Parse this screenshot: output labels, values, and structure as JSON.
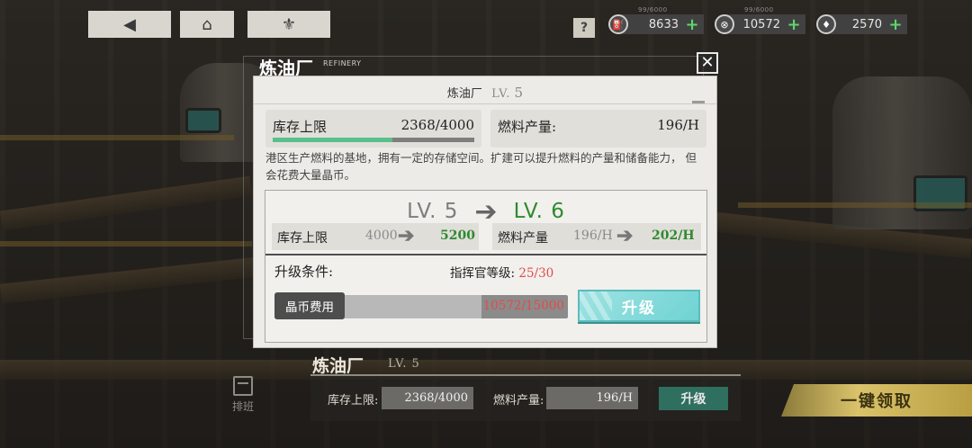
{
  "topbar": {
    "back_label": "◀",
    "home_label": "⌂",
    "base_label": "⚜",
    "help_label": "?"
  },
  "resources": [
    {
      "icon": "oil-icon",
      "glyph": "⛽",
      "caption": "99/6000",
      "value": "8633",
      "plus": "+"
    },
    {
      "icon": "coin-icon",
      "glyph": "⊗",
      "caption": "99/6000",
      "value": "10572",
      "plus": "+"
    },
    {
      "icon": "gem-icon",
      "glyph": "♦",
      "caption": "",
      "value": "2570",
      "plus": "+"
    }
  ],
  "panel": {
    "title": "炼油厂",
    "subtitle": "REFINERY",
    "close_label": "✕"
  },
  "dialog": {
    "name": "炼油厂",
    "lv_prefix": "LV.",
    "level": "5",
    "stock_label": "库存上限",
    "stock_value": "2368/4000",
    "stock_ratio": 0.592,
    "output_label": "燃料产量:",
    "output_value": "196/H",
    "description": "港区生产燃料的基地，拥有一定的存储空间。扩建可以提升燃料的产量和储备能力， 但会花费大量晶币。",
    "upgrade": {
      "from": "LV. 5",
      "arrow": "➔",
      "to": "LV. 6",
      "stock_label": "库存上限",
      "stock_old": "4000",
      "stock_new": "5200",
      "output_label": "燃料产量",
      "output_old": "196/H",
      "output_new": "202/H",
      "cmp_arrow": "➔",
      "condition_label": "升级条件:",
      "commander_label": "指挥官等级:",
      "commander_value": "25/30",
      "cost_label": "晶币费用",
      "cost_value": "10572/15000",
      "cost_ratio": 0.705,
      "button_label": "升级"
    }
  },
  "bottom": {
    "title": "炼油厂",
    "level": "LV. 5",
    "stock_label": "库存上限:",
    "stock_value": "2368/4000",
    "output_label": "燃料产量:",
    "output_value": "196/H",
    "upgrade_label": "升级",
    "collect_label": "一键领取",
    "schedule_label": "排班"
  }
}
